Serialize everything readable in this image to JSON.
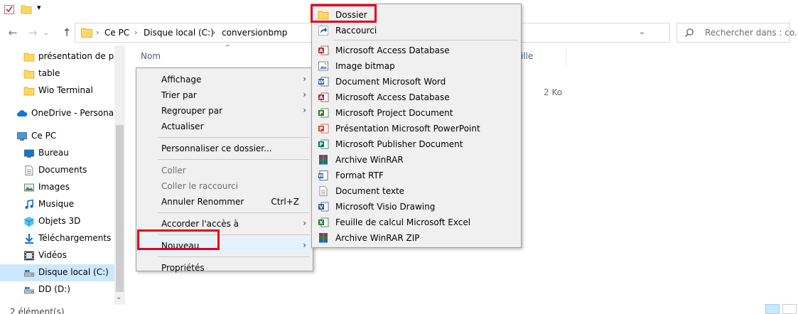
{
  "titlebar": {
    "dropdown_glyph": "▾"
  },
  "nav": {
    "back_glyph": "←",
    "forward_glyph": "→",
    "history_glyph": "⌄",
    "up_glyph": "↑"
  },
  "address": {
    "segments": [
      "Ce PC",
      "Disque local (C:)",
      "conversionbmp"
    ],
    "separator": "›",
    "dropdown_glyph": "⌄",
    "refresh_glyph": "↻"
  },
  "search": {
    "placeholder": "Rechercher dans : co..."
  },
  "sidebar": {
    "items": [
      {
        "label": "présentation de proc",
        "icon": "folder-icon",
        "indent": 1
      },
      {
        "label": "table",
        "icon": "folder-icon",
        "indent": 1
      },
      {
        "label": "Wio Terminal",
        "icon": "folder-icon",
        "indent": 1
      },
      {
        "label": "OneDrive - Personal",
        "icon": "cloud-icon",
        "indent": 0
      },
      {
        "label": "Ce PC",
        "icon": "computer-icon",
        "indent": 0
      },
      {
        "label": "Bureau",
        "icon": "desktop-icon",
        "indent": 1
      },
      {
        "label": "Documents",
        "icon": "documents-icon",
        "indent": 1
      },
      {
        "label": "Images",
        "icon": "images-icon",
        "indent": 1
      },
      {
        "label": "Musique",
        "icon": "music-icon",
        "indent": 1
      },
      {
        "label": "Objets 3D",
        "icon": "cube-icon",
        "indent": 1
      },
      {
        "label": "Téléchargements",
        "icon": "download-icon",
        "indent": 1
      },
      {
        "label": "Vidéos",
        "icon": "video-icon",
        "indent": 1
      },
      {
        "label": "Disque local (C:)",
        "icon": "drive-icon",
        "indent": 1,
        "selected": true
      },
      {
        "label": "DD (D:)",
        "icon": "drive-icon",
        "indent": 1
      }
    ],
    "scroll_down_glyph": "⌄"
  },
  "file_list": {
    "columns": [
      "Nom",
      "ille"
    ],
    "sort_glyph": "^",
    "size_value": "2 Ko"
  },
  "status": {
    "count": "2 élément(s)"
  },
  "context_menu": {
    "items": [
      {
        "label": "Affichage",
        "submenu": true
      },
      {
        "label": "Trier par",
        "submenu": true
      },
      {
        "label": "Regrouper par",
        "submenu": true
      },
      {
        "label": "Actualiser"
      },
      {
        "separator": true
      },
      {
        "label": "Personnaliser ce dossier..."
      },
      {
        "separator": true
      },
      {
        "label": "Coller",
        "disabled": true
      },
      {
        "label": "Coller le raccourci",
        "disabled": true
      },
      {
        "label": "Annuler Renommer",
        "shortcut": "Ctrl+Z"
      },
      {
        "separator": true
      },
      {
        "label": "Accorder l'accès à",
        "submenu": true
      },
      {
        "separator": true
      },
      {
        "label": "Nouveau",
        "submenu": true,
        "hot": true
      },
      {
        "separator": true
      },
      {
        "label": "Propriétés"
      }
    ],
    "arrow_glyph": "›"
  },
  "new_submenu": {
    "items": [
      {
        "label": "Dossier",
        "icon": "folder-icon"
      },
      {
        "label": "Raccourci",
        "icon": "shortcut-icon"
      },
      {
        "separator": true
      },
      {
        "label": "Microsoft Access Database",
        "icon": "access-icon"
      },
      {
        "label": "Image bitmap",
        "icon": "bitmap-icon"
      },
      {
        "label": "Document Microsoft Word",
        "icon": "word-icon"
      },
      {
        "label": "Microsoft Access Database",
        "icon": "access-icon"
      },
      {
        "label": "Microsoft Project Document",
        "icon": "project-icon"
      },
      {
        "label": "Présentation Microsoft PowerPoint",
        "icon": "powerpoint-icon"
      },
      {
        "label": "Microsoft Publisher Document",
        "icon": "publisher-icon"
      },
      {
        "label": "Archive WinRAR",
        "icon": "winrar-icon"
      },
      {
        "label": "Format RTF",
        "icon": "rtf-icon"
      },
      {
        "label": "Document texte",
        "icon": "text-icon"
      },
      {
        "label": "Microsoft Visio Drawing",
        "icon": "visio-icon"
      },
      {
        "label": "Feuille de calcul Microsoft Excel",
        "icon": "excel-icon"
      },
      {
        "label": "Archive WinRAR ZIP",
        "icon": "winrar-zip-icon"
      }
    ]
  },
  "colors": {
    "highlight": "#e3001b",
    "selection": "#cce8ff",
    "menu_bg": "#f0f0f0",
    "folder": "#ffd766"
  }
}
